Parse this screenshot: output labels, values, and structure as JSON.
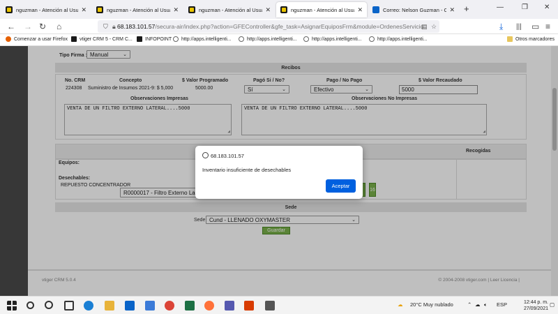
{
  "browser": {
    "tabs": [
      {
        "title": "nguzman - Atención al Usuario",
        "icon": "vtiger-icon",
        "active": false
      },
      {
        "title": "nguzman - Atención al Usuario",
        "icon": "vtiger-icon",
        "active": false
      },
      {
        "title": "nguzman - Atención al Usuario",
        "icon": "vtiger-icon",
        "active": false
      },
      {
        "title": "nguzman - Atención al Usuario",
        "icon": "vtiger-icon",
        "active": true
      },
      {
        "title": "Correo: Nelson Guzman - Outlo",
        "icon": "outlook-icon",
        "active": false
      }
    ],
    "url_host": "68.183.101.57",
    "url_path": "/secura-air/index.php?action=GFEController&gfe_task=AsignarEquiposFrm&module=OrdenesServicio",
    "bookmarks": [
      {
        "label": "Comenzar a usar Firefox",
        "icon": "firefox-icon"
      },
      {
        "label": "vtiger CRM 5 - CRM C...",
        "icon": "vtiger-icon"
      },
      {
        "label": "INFOPOINT",
        "icon": "vtiger-icon"
      },
      {
        "label": "http://apps.intelligenti...",
        "icon": "globe-icon"
      },
      {
        "label": "http://apps.intelligenti...",
        "icon": "globe-icon"
      },
      {
        "label": "http://apps.intelligenti...",
        "icon": "globe-icon"
      },
      {
        "label": "http://apps.intelligenti...",
        "icon": "globe-icon"
      }
    ],
    "other_bookmarks": "Otros marcadores"
  },
  "form": {
    "tipo_firma_label": "Tipo Firma :",
    "tipo_firma_value": "Manual",
    "recibos_header": "Recibos",
    "col_no_crm": "No. CRM",
    "col_concepto": "Concepto",
    "col_valor_programado": "$ Valor Programado",
    "col_pago_si_no": "Pagó Si / No?",
    "col_pago_no_pago": "Pago / No Pago",
    "col_valor_recaudado": "$ Valor Recaudado",
    "row": {
      "no_crm": "224308",
      "concepto": "Suministro de Insumos 2021-9: $ 5,000",
      "valor_programado": "5000.00",
      "pago_si_no": "Sí",
      "pago_no_pago": "Efectivo",
      "valor_recaudado": "5000"
    },
    "obs_impresas_label": "Observaciones Impresas",
    "obs_no_impresas_label": "Observaciones No Impresas",
    "obs_impresas_text": "VENTA DE UN FILTRO EXTERNO LATERAL....5000",
    "obs_no_impresas_text": "VENTA DE UN FILTRO EXTERNO LATERAL....5000",
    "recogidas_label": "Recogidas",
    "equipos_label": "Equipos:",
    "desechables_label": "Desechables:",
    "desechable_item": "REPUESTO CONCENTRADOR",
    "desechable_select": "R0000017 - Filtro Externo La",
    "qty_badge": "16",
    "sede_header": "Sede",
    "sede_label": "Sede",
    "sede_value": "Cund - LLENADO OXYMASTER",
    "guardar_label": "Guardar"
  },
  "footer": {
    "left": "vtiger CRM 5.0.4",
    "right": "© 2004-2008 vtiger.com | Leer Licencia |"
  },
  "dialog": {
    "host": "68.183.101.57",
    "message": "Inventario insuficiente de desechables",
    "ok_label": "Aceptar"
  },
  "taskbar": {
    "weather": "20°C  Muy nublado",
    "lang": "ESP",
    "time": "12:44 p. m.",
    "date": "27/09/2021"
  }
}
